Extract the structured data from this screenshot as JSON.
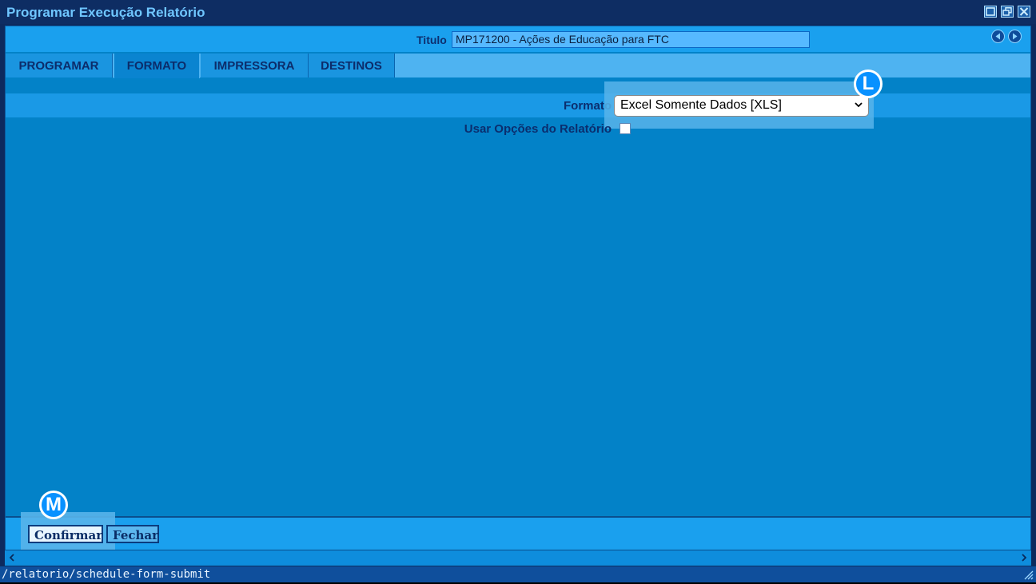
{
  "window": {
    "title": "Programar Execução Relatório"
  },
  "header": {
    "titulo_label": "Titulo",
    "titulo_value": "MP171200 - Ações de Educação para FTC"
  },
  "tabs": [
    {
      "label": "PROGRAMAR"
    },
    {
      "label": "FORMATO"
    },
    {
      "label": "IMPRESSORA"
    },
    {
      "label": "DESTINOS"
    }
  ],
  "form": {
    "formato_label": "Formato",
    "formato_value": "Excel Somente Dados [XLS]",
    "usar_opcoes_label": "Usar Opções do Relatório",
    "usar_opcoes_checked": false
  },
  "callouts": {
    "select_badge": "L",
    "buttons_badge": "M"
  },
  "buttons": {
    "confirm_label": "Confirmar",
    "close_label": "Fechar"
  },
  "statusbar": {
    "url": "/relatorio/schedule-form-submit"
  },
  "icons": {
    "maximize": "maximize-icon",
    "restore": "restore-icon",
    "close": "close-icon",
    "prev": "nav-prev-icon",
    "next": "nav-next-icon",
    "chevron": "chevron-down-icon"
  }
}
